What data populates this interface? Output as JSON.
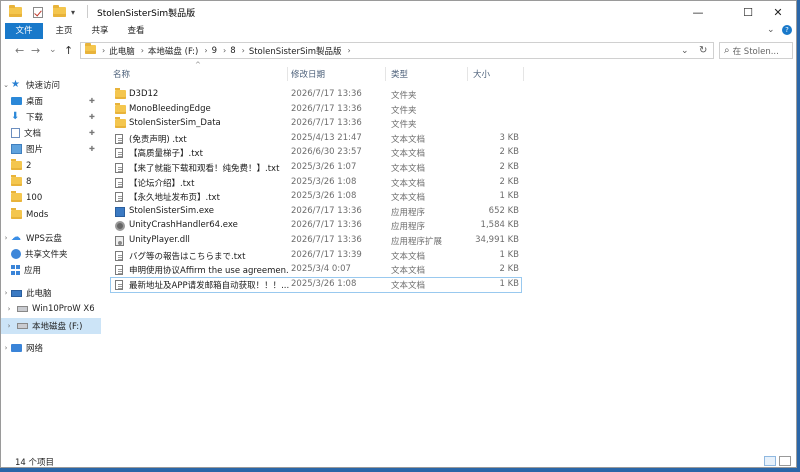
{
  "window": {
    "title": "StolenSisterSim製品版",
    "quick_access_arrow": "▾",
    "minimize": "—",
    "maximize": "☐",
    "close": "✕"
  },
  "ribbon": {
    "tabs": [
      "文件",
      "主页",
      "共享",
      "查看"
    ],
    "expand": "⌄",
    "help": "?"
  },
  "address": {
    "back": "←",
    "forward": "→",
    "recent": "⌄",
    "up": "↑",
    "crumbs": [
      "此电脑",
      "本地磁盘 (F:)",
      "9",
      "8",
      "StolenSisterSim製品版"
    ],
    "separator": "›",
    "dropdown": "⌄",
    "refresh": "↻",
    "search_placeholder": "在 Stolen...",
    "search_icon": "⌕"
  },
  "nav": {
    "items": [
      {
        "label": "快速访问",
        "icon": "star-icon"
      },
      {
        "label": "桌面",
        "icon": "desktop-icon",
        "pinned": true
      },
      {
        "label": "下载",
        "icon": "download-icon",
        "pinned": true
      },
      {
        "label": "文档",
        "icon": "document-icon",
        "pinned": true
      },
      {
        "label": "图片",
        "icon": "picture-icon",
        "pinned": true
      },
      {
        "label": "2",
        "icon": "folder-icon"
      },
      {
        "label": "8",
        "icon": "folder-icon"
      },
      {
        "label": "100",
        "icon": "folder-icon"
      },
      {
        "label": "Mods",
        "icon": "folder-icon"
      },
      {
        "label": "WPS云盘",
        "icon": "cloud-icon"
      },
      {
        "label": "共享文件夹",
        "icon": "share-icon"
      },
      {
        "label": "应用",
        "icon": "apps-icon"
      },
      {
        "label": "此电脑",
        "icon": "pc-icon"
      },
      {
        "label": "Win10ProW X6",
        "icon": "drive-icon"
      },
      {
        "label": "本地磁盘 (F:)",
        "icon": "drive-icon"
      },
      {
        "label": "网络",
        "icon": "network-icon"
      }
    ],
    "pin_glyph": "📌",
    "chevron": "›"
  },
  "columns": {
    "name": "名称",
    "date": "修改日期",
    "type": "类型",
    "size": "大小",
    "sort_arrow": "^"
  },
  "files": [
    {
      "name": "D3D12",
      "date": "2026/7/17 13:36",
      "type": "文件夹",
      "size": "",
      "icon": "folder"
    },
    {
      "name": "MonoBleedingEdge",
      "date": "2026/7/17 13:36",
      "type": "文件夹",
      "size": "",
      "icon": "folder"
    },
    {
      "name": "StolenSisterSim_Data",
      "date": "2026/7/17 13:36",
      "type": "文件夹",
      "size": "",
      "icon": "folder"
    },
    {
      "name": "(免责声明) .txt",
      "date": "2025/4/13 21:47",
      "type": "文本文档",
      "size": "3 KB",
      "icon": "txt"
    },
    {
      "name": "【高质量梯子】.txt",
      "date": "2026/6/30 23:57",
      "type": "文本文档",
      "size": "2 KB",
      "icon": "txt"
    },
    {
      "name": "【来了就能下载和观看！纯免费！】.txt",
      "date": "2025/3/26 1:07",
      "type": "文本文档",
      "size": "2 KB",
      "icon": "txt"
    },
    {
      "name": "【论坛介绍】.txt",
      "date": "2025/3/26 1:08",
      "type": "文本文档",
      "size": "2 KB",
      "icon": "txt"
    },
    {
      "name": "【永久地址发布页】.txt",
      "date": "2025/3/26 1:08",
      "type": "文本文档",
      "size": "1 KB",
      "icon": "txt"
    },
    {
      "name": "StolenSisterSim.exe",
      "date": "2026/7/17 13:36",
      "type": "应用程序",
      "size": "652 KB",
      "icon": "exe"
    },
    {
      "name": "UnityCrashHandler64.exe",
      "date": "2026/7/17 13:36",
      "type": "应用程序",
      "size": "1,584 KB",
      "icon": "gear"
    },
    {
      "name": "UnityPlayer.dll",
      "date": "2026/7/17 13:36",
      "type": "应用程序扩展",
      "size": "34,991 KB",
      "icon": "dll"
    },
    {
      "name": "バグ等の報告はこちらまで.txt",
      "date": "2026/7/17 13:39",
      "type": "文本文档",
      "size": "1 KB",
      "icon": "txt"
    },
    {
      "name": "申明使用协议Affirm the use agreemen...",
      "date": "2025/3/4 0:07",
      "type": "文本文档",
      "size": "2 KB",
      "icon": "txt"
    },
    {
      "name": "最新地址及APP请发邮箱自动获取！！！...",
      "date": "2025/3/26 1:08",
      "type": "文本文档",
      "size": "1 KB",
      "icon": "txt"
    }
  ],
  "status": {
    "count": "14 个项目"
  }
}
